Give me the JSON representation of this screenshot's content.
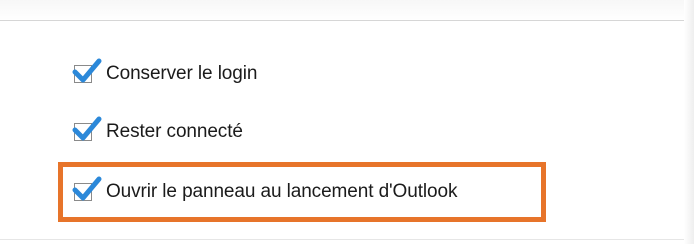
{
  "options": [
    {
      "label": "Conserver le login",
      "checked": true
    },
    {
      "label": "Rester connecté",
      "checked": true
    },
    {
      "label": "Ouvrir le panneau au lancement d'Outlook",
      "checked": true,
      "highlighted": true
    }
  ],
  "colors": {
    "check": "#2b88d9",
    "highlight_border": "#e7742a",
    "text": "#1b1b1b"
  },
  "icons": {
    "check": "checkmark-icon"
  }
}
